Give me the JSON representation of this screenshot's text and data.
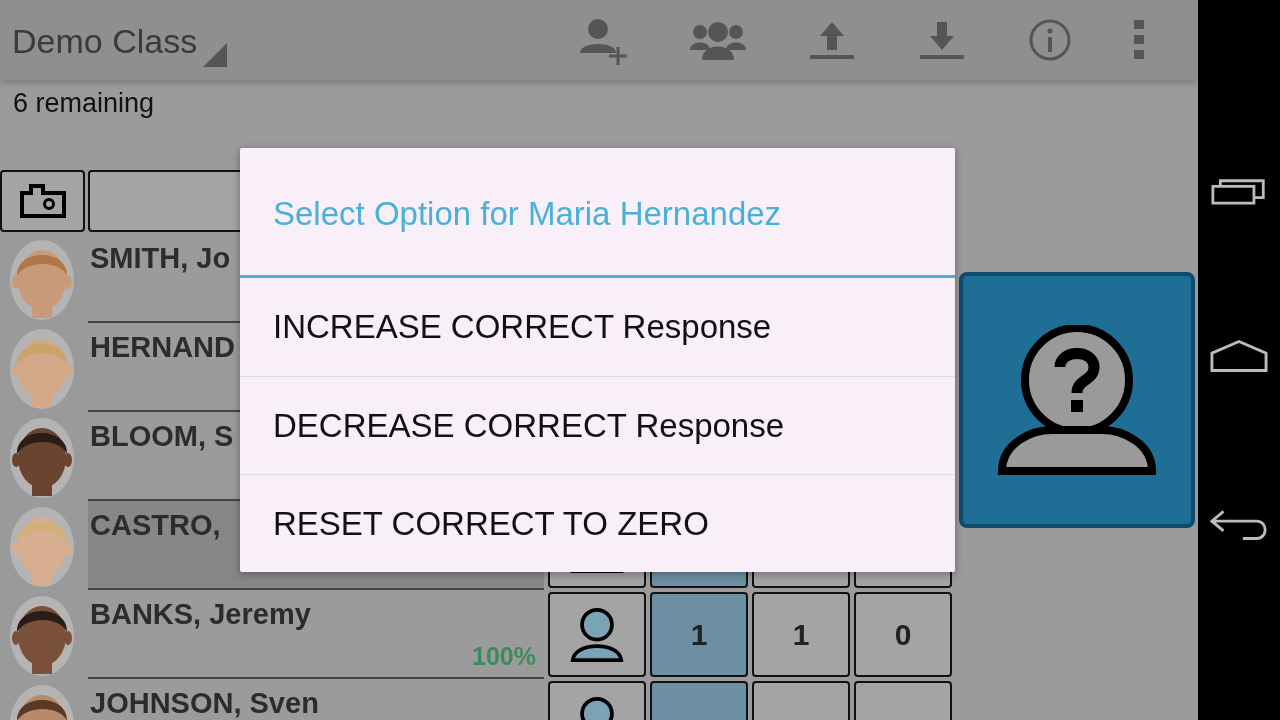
{
  "action_bar": {
    "title": "Demo Class"
  },
  "status": "6 remaining",
  "students": [
    {
      "name": "SMITH, Jo",
      "selected": false
    },
    {
      "name": "HERNAND",
      "selected": false
    },
    {
      "name": "BLOOM, S",
      "selected": false
    },
    {
      "name": "CASTRO,",
      "selected": true
    },
    {
      "name": "BANKS, Jeremy",
      "selected": false,
      "percent": "100%",
      "counts": [
        "1",
        "1",
        "0"
      ]
    },
    {
      "name": "JOHNSON, Sven",
      "selected": false
    }
  ],
  "dialog": {
    "title": "Select Option for Maria Hernandez",
    "options": [
      "INCREASE CORRECT Response",
      "DECREASE CORRECT Response",
      "RESET CORRECT TO ZERO"
    ]
  }
}
